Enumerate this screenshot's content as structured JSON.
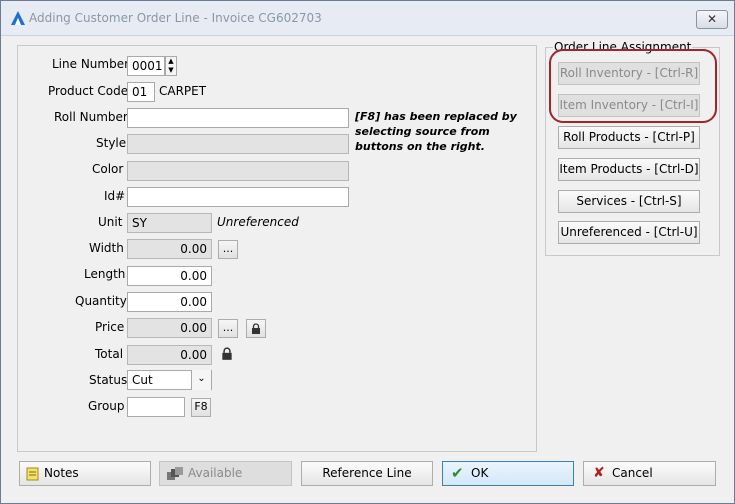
{
  "window": {
    "title": "Adding Customer Order Line - Invoice CG602703",
    "close_label": "✕"
  },
  "form": {
    "line_number": {
      "label": "Line Number",
      "value": "0001"
    },
    "product_code": {
      "label": "Product Code",
      "value": "01",
      "name": "CARPET"
    },
    "roll_number": {
      "label": "Roll Number",
      "value": ""
    },
    "note": "[F8] has been replaced by selecting source from buttons on the right.",
    "style": {
      "label": "Style",
      "value": ""
    },
    "color": {
      "label": "Color",
      "value": ""
    },
    "id": {
      "label": "Id#",
      "value": ""
    },
    "unit": {
      "label": "Unit",
      "value": "SY",
      "status": "Unreferenced"
    },
    "width": {
      "label": "Width",
      "value": "0.00",
      "button": "..."
    },
    "length": {
      "label": "Length",
      "value": "0.00"
    },
    "quantity": {
      "label": "Quantity",
      "value": "0.00"
    },
    "price": {
      "label": "Price",
      "value": "0.00",
      "button": "..."
    },
    "total": {
      "label": "Total",
      "value": "0.00"
    },
    "status_field": {
      "label": "Status",
      "value": "Cut"
    },
    "group": {
      "label": "Group",
      "value": "",
      "button": "F8"
    }
  },
  "assignment": {
    "title": "Order Line Assignment",
    "buttons": [
      {
        "label": "Roll Inventory - [Ctrl-R]",
        "enabled": false
      },
      {
        "label": "Item Inventory - [Ctrl-I]",
        "enabled": false
      },
      {
        "label": "Roll Products - [Ctrl-P]",
        "enabled": true
      },
      {
        "label": "Item Products - [Ctrl-D]",
        "enabled": true
      },
      {
        "label": "Services - [Ctrl-S]",
        "enabled": true
      },
      {
        "label": "Unreferenced - [Ctrl-U]",
        "enabled": true
      }
    ]
  },
  "footer": {
    "notes": "Notes",
    "available": "Available",
    "reference_line": "Reference Line",
    "ok": "OK",
    "cancel": "Cancel"
  },
  "colors": {
    "highlight": "#a0262b",
    "ok_check": "#2f8a2f",
    "cancel_x": "#b02020"
  }
}
